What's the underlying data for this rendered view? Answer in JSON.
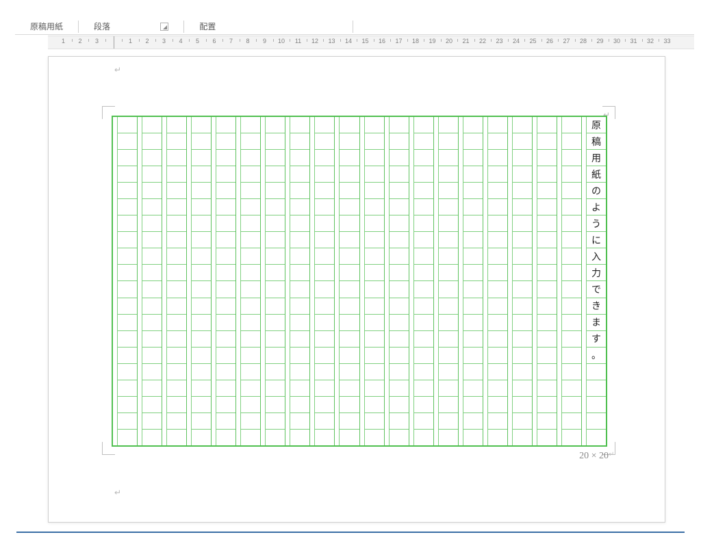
{
  "ribbon": {
    "groups": {
      "genkoyoshi": "原稿用紙",
      "paragraph": "段落",
      "alignment": "配置"
    }
  },
  "ruler": {
    "left_numbers": [
      3,
      2,
      1
    ],
    "right_numbers": [
      1,
      2,
      3,
      4,
      5,
      6,
      7,
      8,
      9,
      10,
      11,
      12,
      13,
      14,
      15,
      16,
      17,
      18,
      19,
      20,
      21,
      22,
      23,
      24,
      25,
      26,
      27,
      28,
      29,
      30,
      31,
      32,
      33
    ]
  },
  "page": {
    "grid_columns": 20,
    "grid_rows": 20,
    "grid_size_label": "20 × 20",
    "content": {
      "column_1_from_right": [
        "原",
        "稿",
        "用",
        "紙",
        "の",
        "よ",
        "う",
        "に",
        "入",
        "力",
        "で",
        "き",
        "ま",
        "す",
        "。"
      ]
    }
  }
}
